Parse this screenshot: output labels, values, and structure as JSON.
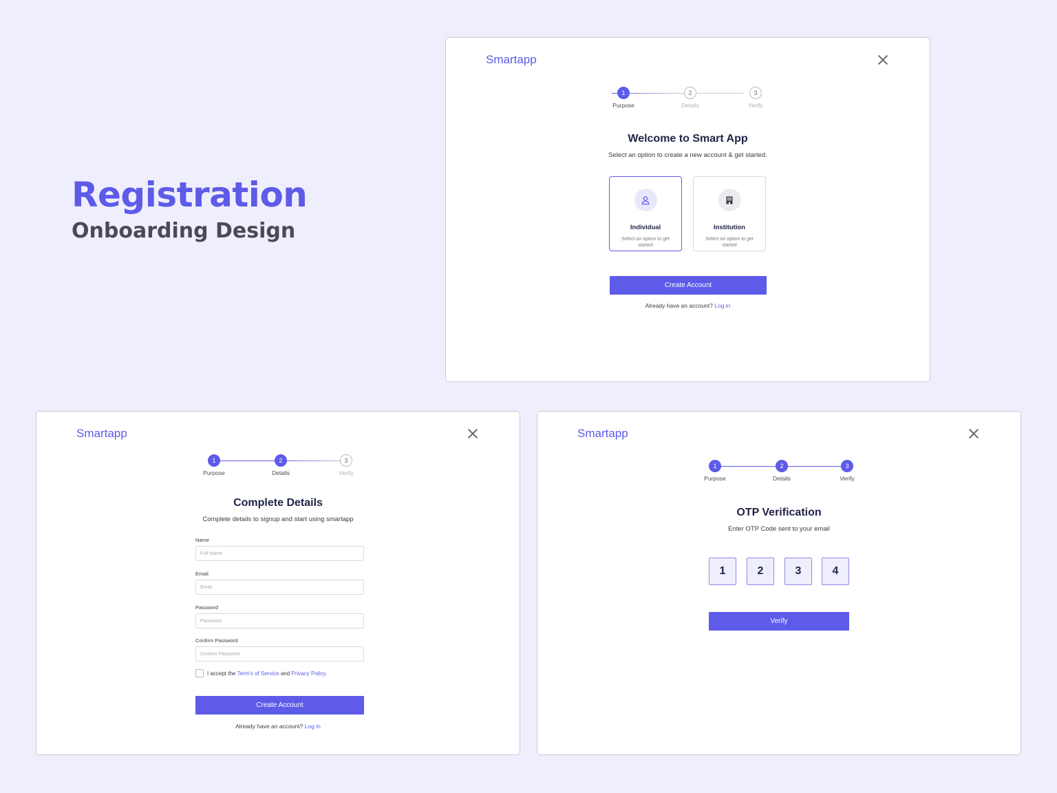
{
  "hero": {
    "title": "Registration",
    "subtitle": "Onboarding Design"
  },
  "brand": "Smartapp",
  "steps": [
    {
      "num": "1",
      "label": "Purpose"
    },
    {
      "num": "2",
      "label": "Details"
    },
    {
      "num": "3",
      "label": "Verify"
    }
  ],
  "screen_purpose": {
    "title": "Welcome to Smart App",
    "subtitle": "Select an option to create a new account & get started.",
    "options": [
      {
        "name": "Individual",
        "desc": "Select an option to get started",
        "icon": "user-icon"
      },
      {
        "name": "Institution",
        "desc": "Select an option to get started",
        "icon": "building-icon"
      }
    ],
    "button": "Create Account",
    "login_prompt": "Already have an account?",
    "login_link": "Log in"
  },
  "screen_details": {
    "title": "Complete Details",
    "subtitle": "Complete details to signup and start using smartapp",
    "fields": [
      {
        "label": "Name",
        "placeholder": "Full Name"
      },
      {
        "label": "Email",
        "placeholder": "Email"
      },
      {
        "label": "Password",
        "placeholder": "Password"
      },
      {
        "label": "Confirm Password",
        "placeholder": "Confirm Password"
      }
    ],
    "terms": {
      "prefix": "I accept the",
      "tos": "Term's of Service",
      "and": "and",
      "privacy": "Privacy Policy."
    },
    "button": "Create Account",
    "login_prompt": "Already have an account?",
    "login_link": "Log in"
  },
  "screen_verify": {
    "title": "OTP Verification",
    "subtitle": "Enter OTP Code sent to your email",
    "otp": [
      "1",
      "2",
      "3",
      "4"
    ],
    "button": "Verify"
  },
  "colors": {
    "accent": "#5d5be8",
    "background": "#efeefc",
    "text": "#1f2447"
  }
}
